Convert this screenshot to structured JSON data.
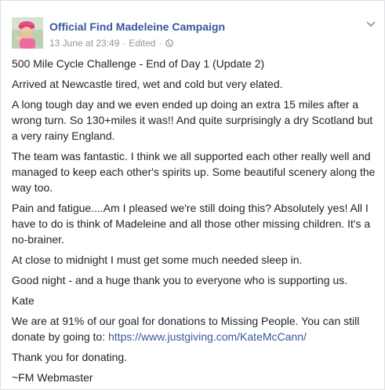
{
  "post": {
    "page_name": "Official Find Madeleine Campaign",
    "timestamp": "13 June at 23:49",
    "edited": "Edited",
    "privacy_icon": "globe-icon",
    "menu_icon": "chevron-down-icon",
    "colors": {
      "link": "#365899",
      "text": "#1d2129",
      "meta": "#90949c"
    },
    "paragraphs": [
      "500 Mile Cycle Challenge - End of Day 1 (Update 2)",
      "Arrived at Newcastle tired, wet and cold but very elated.",
      "A long tough day and we even ended up doing an extra 15 miles after a\nwrong turn. So 130+miles it was!! And quite surprisingly a dry Scotland but\na very rainy England.",
      "The team was fantastic. I think we all supported each other really well and\nmanaged to keep each other's spirits up. Some beautiful scenery along the\nway too.",
      "Pain and fatigue....Am I pleased we're still doing this? Absolutely yes! All I\nhave to do is think of Madeleine and all those other missing children. It's a\nno-brainer.",
      "At close to midnight I must get some much needed sleep in.",
      "Good night - and a huge thank you to everyone who is supporting us.",
      "Kate"
    ],
    "donation_text": "We are at 91% of our goal for donations to Missing People. You can still\ndonate by going to: ",
    "donation_link": "https://www.justgiving.com/KateMcCann/",
    "thanks": "Thank you for donating.",
    "signature": "~FM Webmaster"
  }
}
